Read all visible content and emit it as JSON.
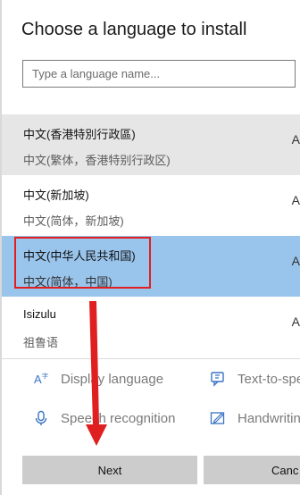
{
  "dialog": {
    "title": "Choose a language to install",
    "search_placeholder": "Type a language name..."
  },
  "languages": [
    {
      "name": "中文(香港特別行政區)",
      "subtitle": "中文(繁体，香港特别行政区)",
      "trailing": "A",
      "state": "hover"
    },
    {
      "name": "中文(新加坡)",
      "subtitle": "中文(简体，新加坡)",
      "trailing": "A",
      "state": "normal"
    },
    {
      "name": "中文(中华人民共和国)",
      "subtitle": "中文(简体，中国)",
      "trailing": "A",
      "state": "selected"
    },
    {
      "name": "Isizulu",
      "subtitle": "祖鲁语",
      "trailing": "A",
      "state": "normal"
    }
  ],
  "features": [
    {
      "label": "Display language",
      "icon": "display-language-icon"
    },
    {
      "label": "Text-to-spe",
      "icon": "text-to-speech-icon"
    },
    {
      "label": "Speech recognition",
      "icon": "microphone-icon"
    },
    {
      "label": "Handwritin",
      "icon": "handwriting-icon"
    }
  ],
  "buttons": {
    "next": "Next",
    "cancel": "Canc"
  },
  "colors": {
    "selected": "#99c4ec",
    "hover": "#e6e6e6",
    "annotation": "#e02020",
    "button": "#cccccc"
  }
}
